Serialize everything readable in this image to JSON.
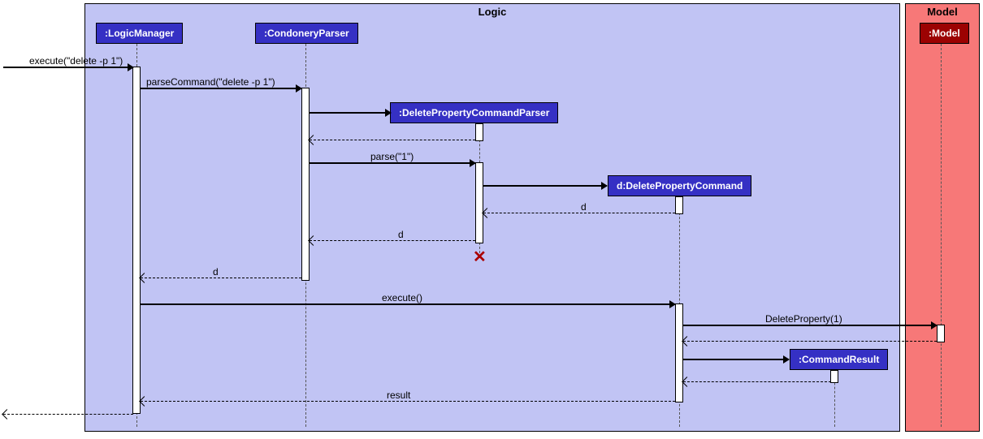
{
  "frames": {
    "logic": "Logic",
    "model": "Model"
  },
  "participants": {
    "logicManager": ":LogicManager",
    "condoneryParser": ":CondoneryParser",
    "deletePropertyCommandParser": ":DeletePropertyCommandParser",
    "deletePropertyCommand": "d:DeletePropertyCommand",
    "commandResult": ":CommandResult",
    "model": ":Model"
  },
  "messages": {
    "m1": "execute(\"delete -p 1\")",
    "m2": "parseCommand(\"delete -p 1\")",
    "m3": "parse(\"1\")",
    "m4": "d",
    "m5": "d",
    "m6": "d",
    "m7": "execute()",
    "m8": "DeleteProperty(1)",
    "m9": "result"
  }
}
